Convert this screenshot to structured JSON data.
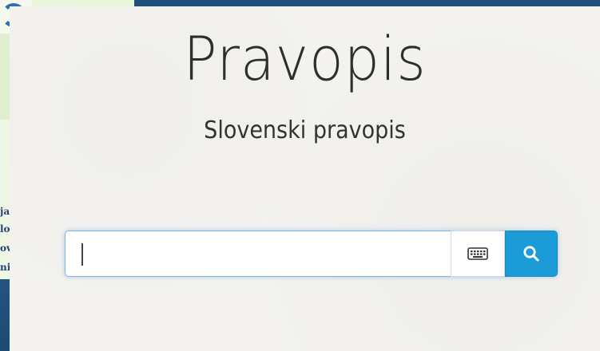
{
  "page": {
    "title": "Pravopis",
    "subtitle": "Slovenski pravopis"
  },
  "search": {
    "value": "",
    "placeholder": "",
    "keyboard_icon": "keyboard-icon",
    "search_icon": "magnifier-icon"
  },
  "background": {
    "side_text": [
      "ja",
      "lo",
      "ov",
      "ni"
    ]
  },
  "colors": {
    "accent": "#1b9bd8",
    "panel": "#f3f2ef",
    "text": "#2e2e2e"
  }
}
